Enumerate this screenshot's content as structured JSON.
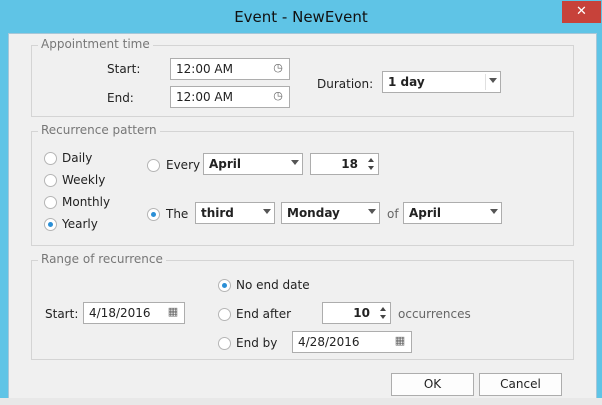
{
  "window": {
    "title": "Event - NewEvent",
    "close_glyph": "✕"
  },
  "appointment": {
    "group_title": "Appointment time",
    "start_label": "Start:",
    "start_value": "12:00 AM",
    "end_label": "End:",
    "end_value": "12:00 AM",
    "duration_label": "Duration:",
    "duration_value": "1 day"
  },
  "recurrence": {
    "group_title": "Recurrence pattern",
    "options": [
      {
        "label": "Daily",
        "checked": false
      },
      {
        "label": "Weekly",
        "checked": false
      },
      {
        "label": "Monthly",
        "checked": false
      },
      {
        "label": "Yearly",
        "checked": true
      }
    ],
    "every_label": "Every",
    "every_month": "April",
    "every_day": "18",
    "the_label": "The",
    "the_ordinal": "third",
    "the_weekday": "Monday",
    "of_label": "of",
    "of_month": "April",
    "mode": "the"
  },
  "range": {
    "group_title": "Range of recurrence",
    "start_label": "Start:",
    "start_value": "4/18/2016",
    "no_end_label": "No end date",
    "end_after_label": "End after",
    "end_after_value": "10",
    "occurrences_label": "occurrences",
    "end_by_label": "End by",
    "end_by_value": "4/28/2016",
    "selected": "no_end"
  },
  "buttons": {
    "ok": "OK",
    "cancel": "Cancel"
  },
  "icons": {
    "clock": "clock-icon",
    "calendar": "calendar-icon",
    "dropdown": "chevron-down-icon"
  },
  "colors": {
    "titlebar": "#5fc4e6",
    "close": "#c7423a",
    "radio_checked": "#2b8fd6",
    "client": "#f0f0f0"
  }
}
